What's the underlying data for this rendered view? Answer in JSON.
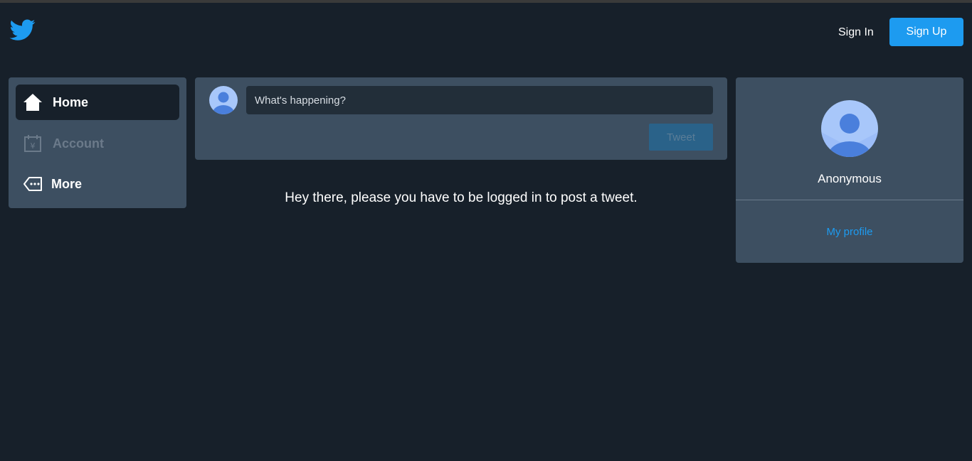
{
  "header": {
    "logo_icon": "twitter-bird-icon",
    "signin_label": "Sign In",
    "signup_label": "Sign Up",
    "accent_color": "#1d9bf0"
  },
  "sidebar": {
    "items": [
      {
        "label": "Home",
        "icon": "home-icon",
        "active": true
      },
      {
        "label": "Account",
        "icon": "calendar-yen-icon",
        "disabled": true
      },
      {
        "label": "More",
        "icon": "more-tag-icon"
      }
    ]
  },
  "composer": {
    "placeholder": "What's happening?",
    "tweet_label": "Tweet"
  },
  "notice": {
    "text": "Hey there, please you have to be logged in to post a tweet."
  },
  "profile": {
    "name": "Anonymous",
    "link_label": "My profile"
  }
}
